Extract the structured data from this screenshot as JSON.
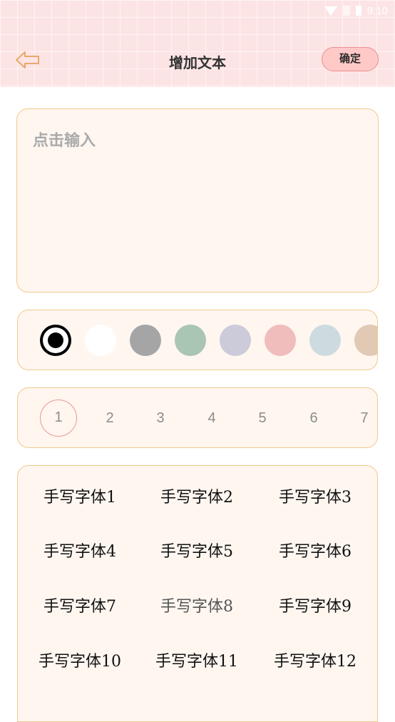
{
  "status_bar": {
    "time": "9:10",
    "icons": [
      "wifi-icon",
      "sim-icon",
      "battery-icon"
    ]
  },
  "header": {
    "title": "增加文本",
    "confirm_label": "确定",
    "back_icon": "arrow-left-icon"
  },
  "text_input": {
    "value": "",
    "placeholder": "点击输入"
  },
  "colors": {
    "swatches": [
      "#000000",
      "#ffffff",
      "#a5a5a5",
      "#a9c5b4",
      "#cccbda",
      "#f0bcbc",
      "#cddbe0",
      "#e1c9b3"
    ],
    "selected_index": 0
  },
  "sizes": {
    "items": [
      "1",
      "2",
      "3",
      "4",
      "5",
      "6",
      "7"
    ],
    "selected_index": 0
  },
  "fonts": {
    "items": [
      "手写字体1",
      "手写字体2",
      "手写字体3",
      "手写字体4",
      "手写字体5",
      "手写字体6",
      "手写字体7",
      "手写字体8",
      "手写字体9",
      "手写字体10",
      "手写字体11",
      "手写字体12"
    ]
  },
  "theme": {
    "header_bg": "#fde4e4",
    "card_bg": "#fff6f0",
    "card_border": "#f3c98a",
    "accent": "#eb9595"
  }
}
